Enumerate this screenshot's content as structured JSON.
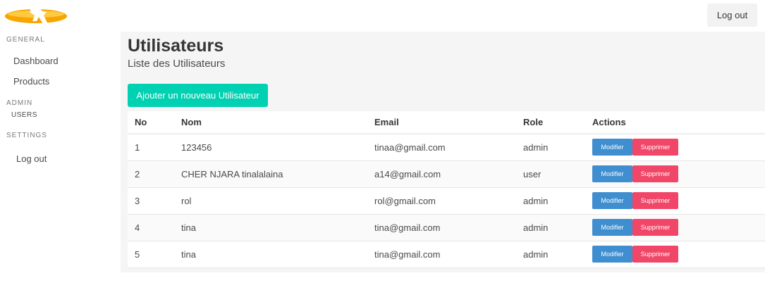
{
  "header": {
    "logout_label": "Log out"
  },
  "sidebar": {
    "general_label": "General",
    "general_items": [
      "Dashboard",
      "Products"
    ],
    "admin_label": "Admin",
    "admin_items": [
      "Users"
    ],
    "settings_label": "Settings",
    "settings_items": [
      "Log out"
    ]
  },
  "main": {
    "title": "Utilisateurs",
    "subtitle": "Liste des Utilisateurs",
    "add_button": "Ajouter un nouveau Utilisateur"
  },
  "table": {
    "headers": [
      "No",
      "Nom",
      "Email",
      "Role",
      "Actions"
    ],
    "rows": [
      {
        "no": "1",
        "nom": "123456",
        "email": "tinaa@gmail.com",
        "role": "admin"
      },
      {
        "no": "2",
        "nom": "CHER NJARA tinalalaina",
        "email": "a14@gmail.com",
        "role": "user"
      },
      {
        "no": "3",
        "nom": "rol",
        "email": "rol@gmail.com",
        "role": "admin"
      },
      {
        "no": "4",
        "nom": "tina",
        "email": "tina@gmail.com",
        "role": "admin"
      },
      {
        "no": "5",
        "nom": "tina",
        "email": "tina@gmail.com",
        "role": "admin"
      }
    ],
    "modify_label": "Modifier",
    "delete_label": "Supprimer"
  },
  "colors": {
    "primary": "#00d1b2",
    "info": "#3e8ed0",
    "danger": "#f14668",
    "logo": "#f7a500"
  },
  "icons": {
    "logo": "brand-logo"
  }
}
